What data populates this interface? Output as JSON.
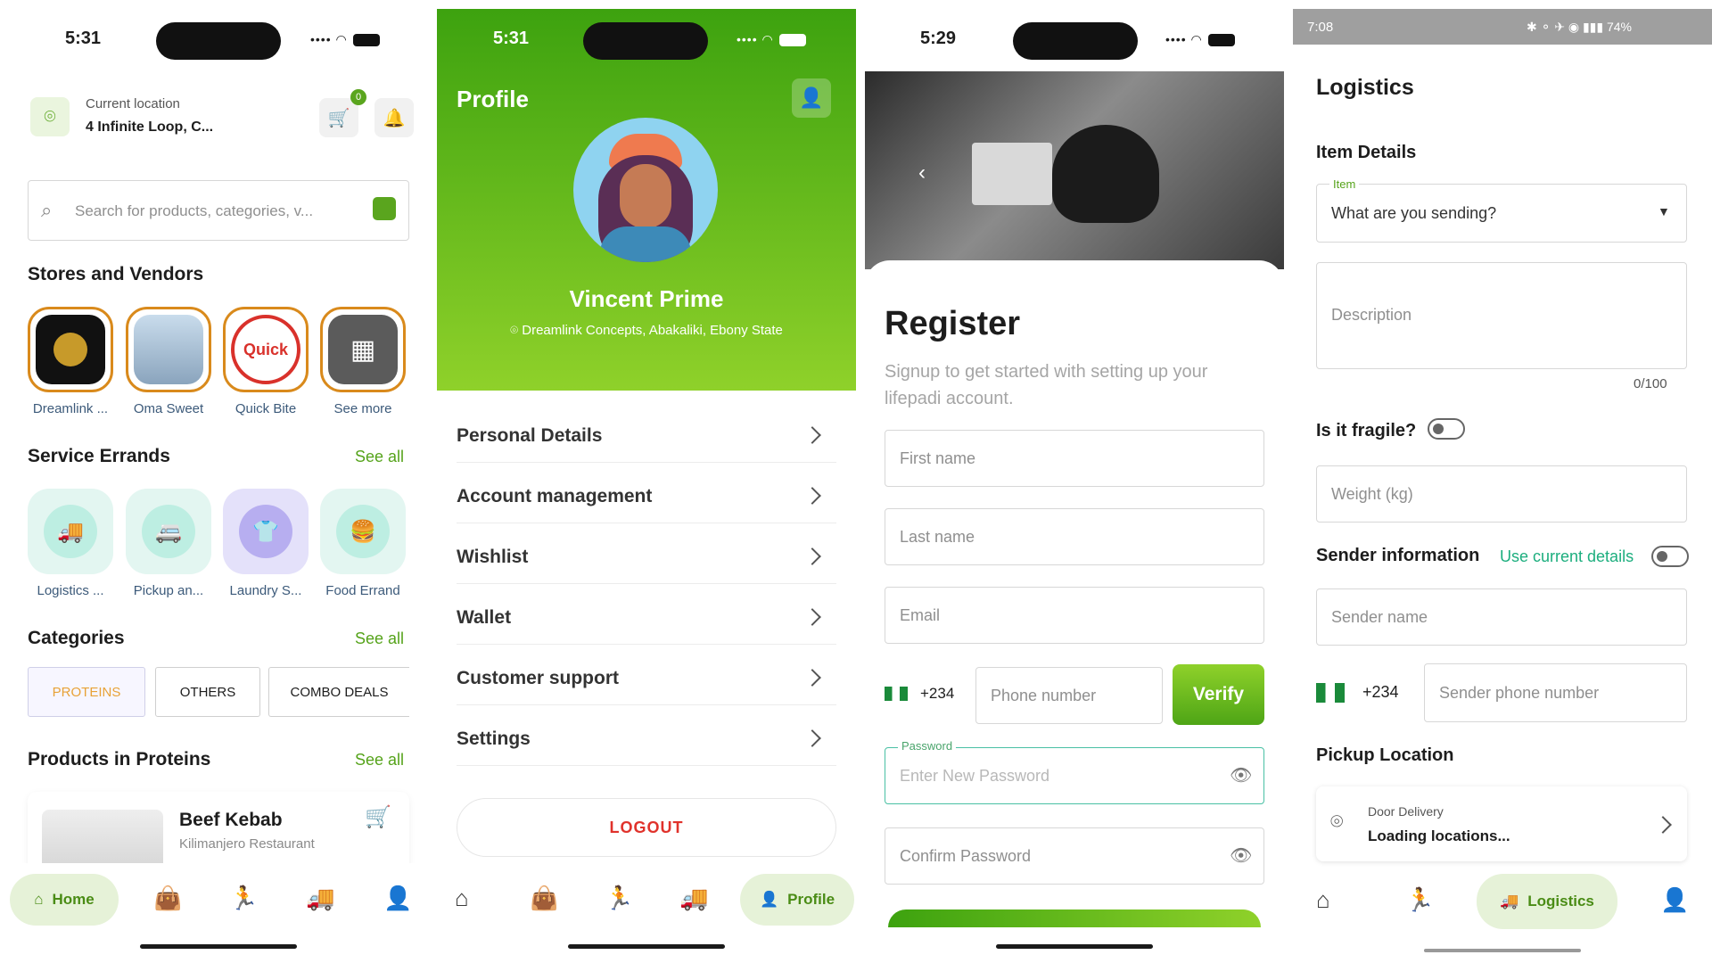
{
  "home": {
    "status_time": "5:31",
    "location_label": "Current location",
    "location_value": "4 Infinite Loop, C...",
    "cart_count": "0",
    "search_placeholder": "Search for products, categories, v...",
    "stores_title": "Stores and Vendors",
    "stores": [
      "Dreamlink ...",
      "Oma Sweet",
      "Quick Bite",
      "See more"
    ],
    "errands_title": "Service Errands",
    "errands_see_all": "See all",
    "errands": [
      "Logistics ...",
      "Pickup an...",
      "Laundry S...",
      "Food Errand"
    ],
    "categories_title": "Categories",
    "categories_see_all": "See all",
    "categories": [
      "PROTEINS",
      "OTHERS",
      "COMBO DEALS"
    ],
    "products_title": "Products in Proteins",
    "products_see_all": "See all",
    "product_name": "Beef Kebab",
    "product_vendor": "Kilimanjero Restaurant",
    "quick_bite_logo": "Quick",
    "nav_home": "Home",
    "colors": {
      "accent": "#5aa51e",
      "store_ring": "#d98a1c",
      "category_active": "#e8a237"
    }
  },
  "profile": {
    "status_time": "5:31",
    "title": "Profile",
    "name": "Vincent Prime",
    "address": "Dreamlink Concepts, Abakaliki, Ebony State",
    "menu": [
      "Personal Details",
      "Account management",
      "Wishlist",
      "Wallet",
      "Customer support",
      "Settings"
    ],
    "logout": "LOGOUT",
    "nav_profile": "Profile",
    "colors": {
      "header_start": "#3da20f",
      "header_end": "#8fd12a",
      "logout": "#e0322b"
    }
  },
  "register": {
    "status_time": "5:29",
    "title": "Register",
    "subtitle": "Signup to get started with setting up your lifepadi account.",
    "first_name": "First name",
    "last_name": "Last name",
    "email": "Email",
    "country_code": "+234",
    "phone": "Phone number",
    "verify": "Verify",
    "password_label": "Password",
    "password_placeholder": "Enter New Password",
    "confirm_password": "Confirm Password"
  },
  "logistics": {
    "status_time": "7:08",
    "battery": "74%",
    "title": "Logistics",
    "item_details": "Item Details",
    "item_label": "Item",
    "item_select": "What are you sending?",
    "description": "Description",
    "char_count": "0/100",
    "fragile": "Is it fragile?",
    "weight": "Weight (kg)",
    "sender_info": "Sender information",
    "use_current": "Use current details",
    "sender_name": "Sender name",
    "country_code": "+234",
    "sender_phone": "Sender phone number",
    "pickup_location": "Pickup Location",
    "door_delivery": "Door Delivery",
    "loading": "Loading locations...",
    "nav_logistics": "Logistics"
  }
}
